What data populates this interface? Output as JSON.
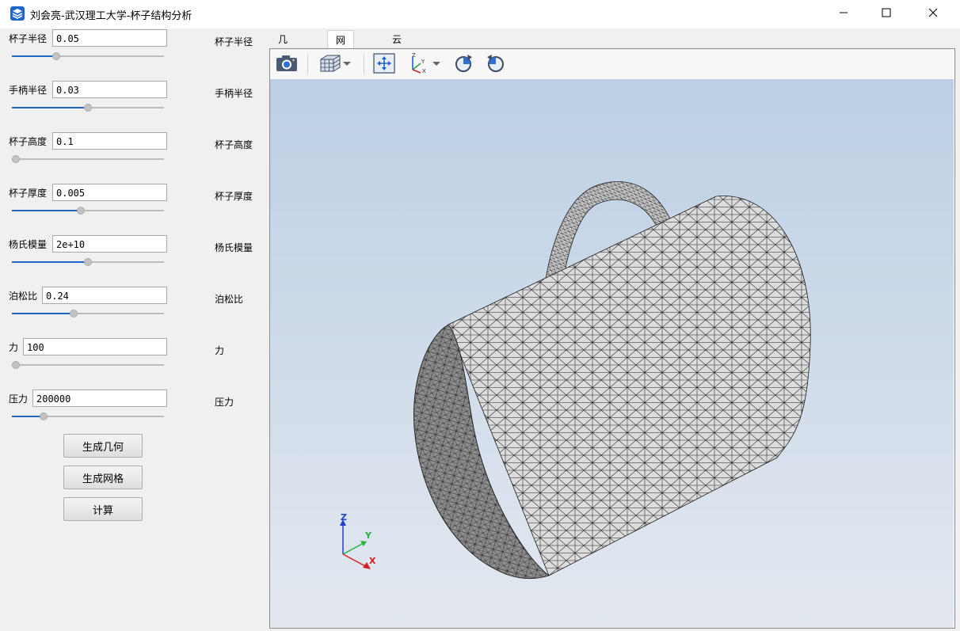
{
  "window": {
    "title": "刘会亮-武汉理工大学-杯子结构分析",
    "app_icon": "layers-app-icon",
    "minimize_icon": "minimize-icon",
    "maximize_icon": "maximize-icon",
    "close_icon": "close-icon"
  },
  "params": [
    {
      "label": "杯子半径",
      "value": "0.05",
      "right_label": "杯子半径",
      "slider_fraction": 0.28
    },
    {
      "label": "手柄半径",
      "value": "0.03",
      "right_label": "手柄半径",
      "slider_fraction": 0.5
    },
    {
      "label": "杯子高度",
      "value": "0.1",
      "right_label": "杯子高度",
      "slider_fraction": 0.0
    },
    {
      "label": "杯子厚度",
      "value": "0.005",
      "right_label": "杯子厚度",
      "slider_fraction": 0.45
    },
    {
      "label": "杨氏模量",
      "value": "2e+10",
      "right_label": "杨氏模量",
      "slider_fraction": 0.5
    },
    {
      "label": "泊松比",
      "value": "0.24",
      "right_label": "泊松比",
      "slider_fraction": 0.4
    },
    {
      "label": "力",
      "value": "100",
      "right_label": "力",
      "slider_fraction": 0.0
    },
    {
      "label": "压力",
      "value": "200000",
      "right_label": "压力",
      "slider_fraction": 0.19
    }
  ],
  "buttons": {
    "generate_geometry": "生成几何",
    "generate_mesh": "生成网格",
    "compute": "计算"
  },
  "tabs": [
    {
      "label": "几何表单",
      "active": false
    },
    {
      "label": "网格表单",
      "active": true
    },
    {
      "label": "云图表单",
      "active": false
    }
  ],
  "toolbar": {
    "items": [
      "camera-icon",
      "view-cube-icon",
      "fit-all-icon",
      "axes-orientation-icon",
      "rotate-clockwise-icon",
      "rotate-counterclockwise-icon"
    ]
  },
  "axes": {
    "z": "Z",
    "y": "Y",
    "x": "X"
  },
  "colors": {
    "accent": "#1f66c8",
    "viewport_top": "#bccfe5",
    "viewport_bottom": "#e3e8ef",
    "mesh_fill": "#d9d9d9",
    "mesh_edge": "#1a1a1a"
  }
}
